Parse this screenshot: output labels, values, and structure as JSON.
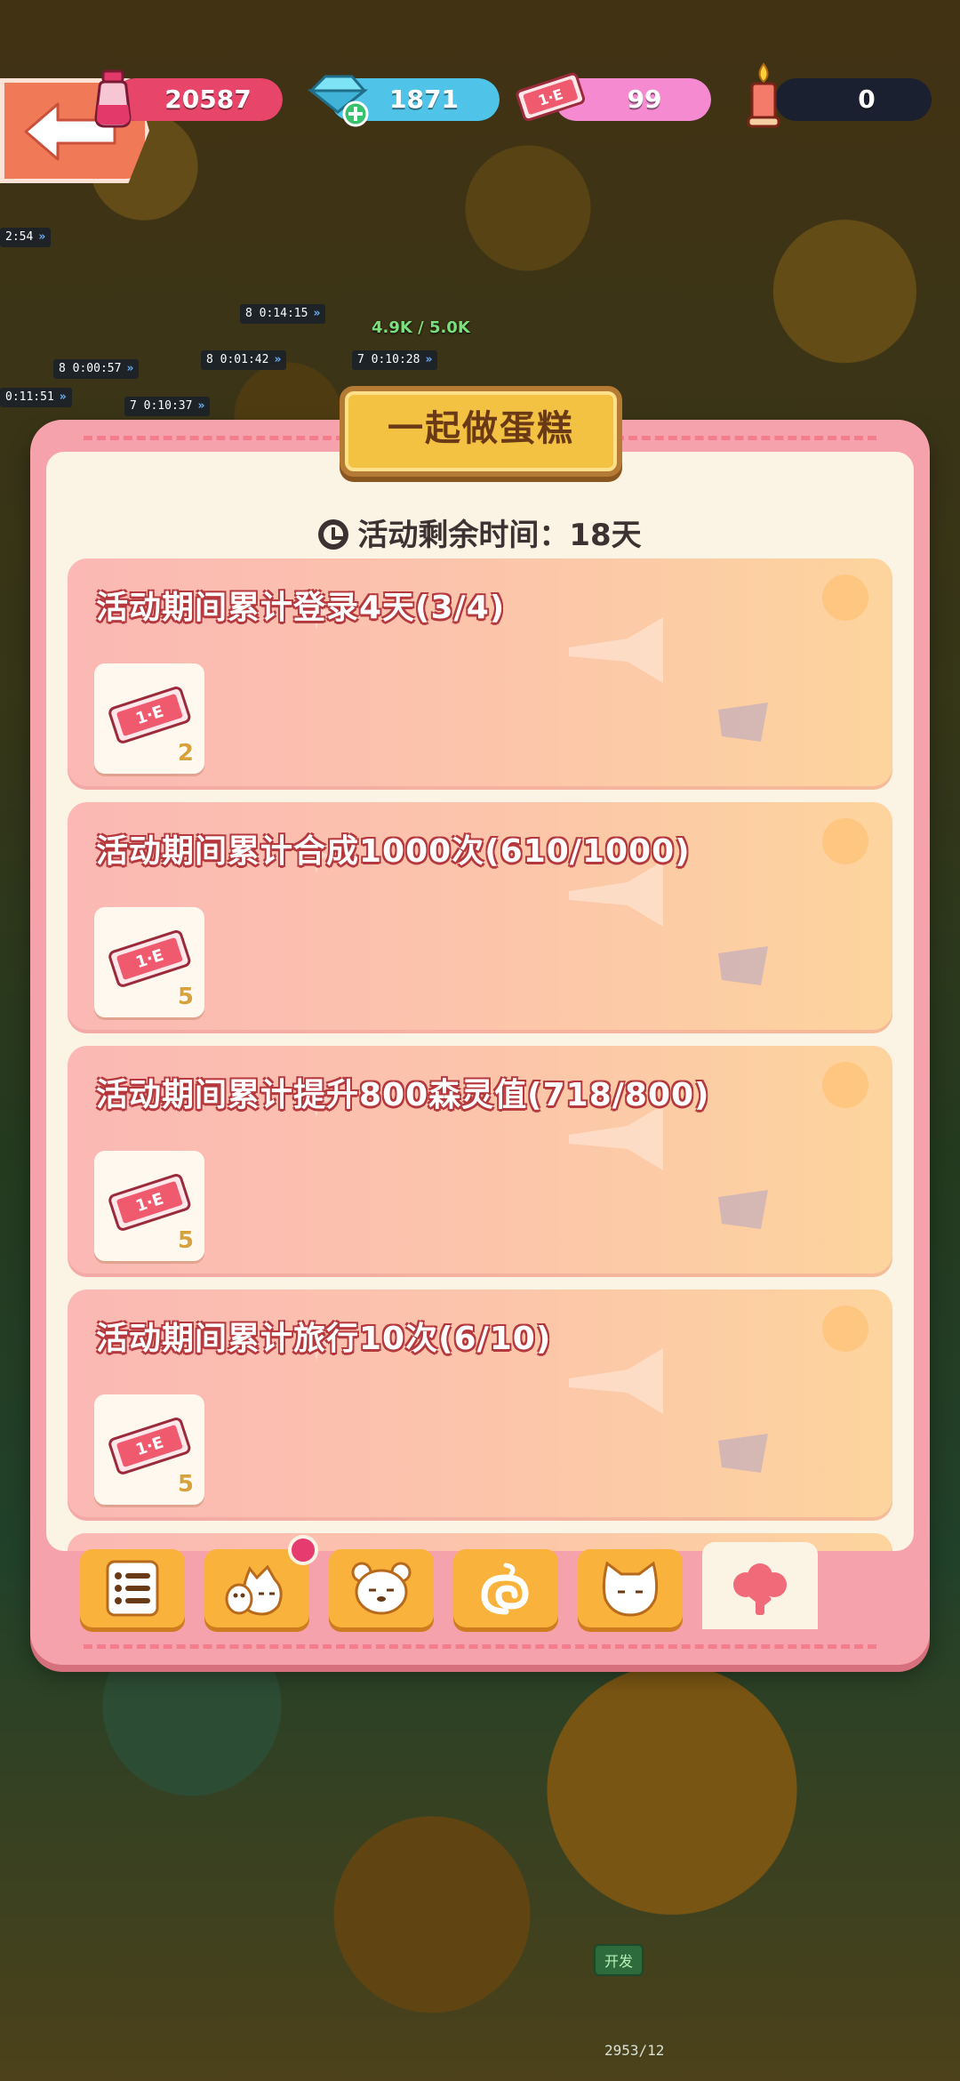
{
  "resources": {
    "ink": {
      "value": "20587",
      "icon": "ink-bottle-icon",
      "color": "#e8456a"
    },
    "gems": {
      "value": "1871",
      "icon": "gem-icon",
      "color": "#4fc3e8"
    },
    "tickets": {
      "value": "99",
      "icon": "ticket-icon",
      "color": "#f58ad0"
    },
    "candle": {
      "value": "0",
      "icon": "candle-icon",
      "color": "#1b2030"
    }
  },
  "event": {
    "title": "一起做蛋糕",
    "time_remaining": "活动剩余时间：18天"
  },
  "tasks": [
    {
      "title": "活动期间累计登录4天(3/4)",
      "reward_icon": "ticket-icon",
      "reward_count": "2"
    },
    {
      "title": "活动期间累计合成1000次(610/1000)",
      "reward_icon": "ticket-icon",
      "reward_count": "5"
    },
    {
      "title": "活动期间累计提升800森灵值(718/800)",
      "reward_icon": "ticket-icon",
      "reward_count": "5"
    },
    {
      "title": "活动期间累计旅行10次(6/10)",
      "reward_icon": "ticket-icon",
      "reward_count": "5"
    }
  ],
  "tabs": [
    {
      "icon": "list-icon",
      "active": false,
      "badge": false
    },
    {
      "icon": "cat-chick-icon",
      "active": false,
      "badge": true
    },
    {
      "icon": "bear-icon",
      "active": false,
      "badge": false
    },
    {
      "icon": "swirl-icon",
      "active": false,
      "badge": false
    },
    {
      "icon": "cat-icon",
      "active": false,
      "badge": false
    },
    {
      "icon": "tree-icon",
      "active": true,
      "badge": false
    }
  ],
  "background": {
    "timers": [
      {
        "level": "",
        "time": "2:54"
      },
      {
        "level": "8",
        "time": "0:14:15"
      },
      {
        "level": "8",
        "time": "0:00:57"
      },
      {
        "level": "8",
        "time": "0:01:42"
      },
      {
        "level": "7",
        "time": "0:10:28"
      },
      {
        "level": "",
        "time": "0:11:51"
      },
      {
        "level": "7",
        "time": "0:10:37"
      }
    ],
    "float_text": "4.9K / 5.0K",
    "sign_text": "开发",
    "bottom_label": "2953/12"
  }
}
